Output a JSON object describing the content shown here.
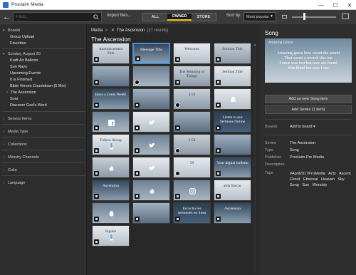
{
  "app": {
    "title": "Proclaim Media"
  },
  "window": {
    "minimize": "—",
    "maximize": "☐",
    "close": "✕"
  },
  "toolbar": {
    "search_placeholder": "Find...",
    "import_label": "Import files...",
    "tabs": [
      "ALL",
      "OWNED",
      "STORE"
    ],
    "active_tab": "OWNED",
    "sort_label": "Sort by:",
    "sort_value": "Most popular"
  },
  "sidebar": {
    "boards_label": "Boards",
    "boards": [
      "Group Upload",
      "Favorites"
    ],
    "service_label": "Sunday, August 20",
    "service_items": [
      "Kraft Air Balloon",
      "Sun Rays",
      "Upcoming Events",
      "It is Finished",
      "Bible Verses Countdown (5 Min)",
      "The Ascension",
      "Soar",
      "Discover God's Word"
    ],
    "checked_item": "The Ascension",
    "sections": [
      "Service Items",
      "Media Type",
      "Collections",
      "Ministry Channels",
      "Color",
      "Language"
    ]
  },
  "main": {
    "crumb_root": "Media",
    "crumb_sep": ">",
    "crumb_current": "The Ascension",
    "crumb_count": "(27 results)",
    "title": "The Ascension",
    "tiles": [
      {
        "text": "Announcement Title",
        "style": "t1",
        "badge": "badge"
      },
      {
        "text": "Message Title",
        "style": "t2",
        "badge": "badge",
        "selected": true
      },
      {
        "text": "Welcome",
        "style": "t3",
        "badge": "badge"
      },
      {
        "text": "Sermon Title",
        "style": "t4",
        "badge": "badge"
      },
      {
        "text": "",
        "style": "t5",
        "badge": "badge"
      },
      {
        "text": "",
        "style": "t6",
        "badge": "play"
      },
      {
        "text": "The Meaning of Things",
        "style": "t4",
        "badge": "badge"
      },
      {
        "text": "Sermon Title",
        "style": "t3",
        "badge": "badge"
      },
      {
        "text": "Have a Great Week!",
        "style": "t2",
        "badge": "badge"
      },
      {
        "text": "",
        "style": "t5",
        "badge": "badge"
      },
      {
        "text": "4:59",
        "style": "t4",
        "badge": "play"
      },
      {
        "text": "",
        "style": "t3",
        "badge": "badge",
        "icon": "bell"
      },
      {
        "text": "",
        "style": "t6",
        "badge": "badge",
        "icon": "facebook"
      },
      {
        "text": "",
        "style": "t3",
        "badge": "badge",
        "icon": "twitter"
      },
      {
        "text": "",
        "style": "t5",
        "badge": "badge"
      },
      {
        "text": "Listen to our Sermons Online",
        "style": "t7",
        "badge": "badge"
      },
      {
        "text": "Follow Along",
        "style": "t3",
        "badge": "badge",
        "icon": "phone"
      },
      {
        "text": "",
        "style": "t6",
        "badge": "badge",
        "icon": "twitter"
      },
      {
        "text": "2:59",
        "style": "t4",
        "badge": "play"
      },
      {
        "text": "",
        "style": "t5",
        "badge": "badge"
      },
      {
        "text": "",
        "style": "t4",
        "badge": "badge",
        "icon": "flame"
      },
      {
        "text": "",
        "style": "t3",
        "badge": "badge",
        "icon": "twitter"
      },
      {
        "text": "59",
        "style": "t3",
        "badge": "play"
      },
      {
        "text": "Your digital bulletin",
        "style": "t2",
        "badge": "badge"
      },
      {
        "text": "Ascension",
        "style": "t2",
        "badge": "badge"
      },
      {
        "text": "",
        "style": "t6",
        "badge": "badge",
        "icon": "flame"
      },
      {
        "text": "",
        "style": "t6",
        "badge": "badge",
        "icon": "instagram"
      },
      {
        "text": "ama buscar",
        "style": "t3",
        "badge": "badge"
      },
      {
        "text": "",
        "style": "t6",
        "badge": "badge",
        "icon": "snapchat"
      },
      {
        "text": "",
        "style": "t5",
        "badge": "badge"
      },
      {
        "text": "Escucha los sermones en linea",
        "style": "t7",
        "badge": "badge"
      },
      {
        "text": "Ascension",
        "style": "t2",
        "badge": "badge"
      },
      {
        "text": "Siguen",
        "style": "t3",
        "badge": "badge",
        "icon": "phone"
      }
    ]
  },
  "right": {
    "heading": "Song",
    "preview_title": "Amazing Grace",
    "preview_lines": [
      "Amazing grace how sweet the sound",
      "That saved a wretch like me",
      "I once was lost but now am found",
      "Was blind but now I see"
    ],
    "add_song_label": "Add as new Song item",
    "add_series_label": "Add Series (1 item)",
    "boards_label": "Boards",
    "add_board_label": "Add to board",
    "add_board_caret": "▾",
    "series_label": "Series",
    "series_value": "The Ascension",
    "type_label": "Type",
    "type_value": "Song",
    "publisher_label": "Publisher",
    "publisher_value": "Proclaim Pro Media",
    "description_label": "Description",
    "tags_label": "Tags",
    "tags": [
      "#April2017ProMedia",
      "Acts",
      "Ascent",
      "Cloud",
      "Ethereal",
      "Heaven",
      "Sky",
      "Song",
      "Sun",
      "Worship"
    ]
  }
}
